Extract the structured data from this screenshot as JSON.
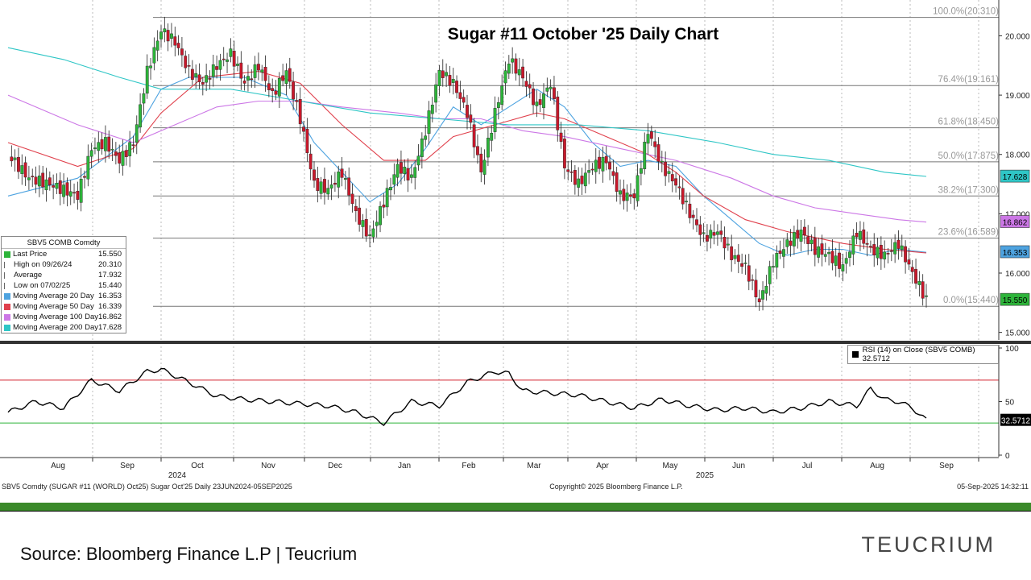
{
  "chart_data": {
    "type": "candlestick",
    "title": "Sugar #11 October '25 Daily Chart",
    "ylim": [
      14.9,
      20.4
    ],
    "y_ticks": [
      "15.000",
      "16.000",
      "17.000",
      "18.000",
      "19.000",
      "20.000"
    ],
    "x_labels": [
      "Aug",
      "Sep",
      "Oct",
      "Nov",
      "Dec",
      "Jan",
      "Feb",
      "Mar",
      "Apr",
      "May",
      "Jun",
      "Jul",
      "Aug",
      "Sep"
    ],
    "year_labels": [
      "2024",
      "2025"
    ],
    "fib_levels": [
      {
        "label": "100.0%(20.310)",
        "value": 20.31
      },
      {
        "label": "76.4%(19.161)",
        "value": 19.161
      },
      {
        "label": "61.8%(18.450)",
        "value": 18.45
      },
      {
        "label": "50.0%(17.875)",
        "value": 17.875
      },
      {
        "label": "38.2%(17.300)",
        "value": 17.3
      },
      {
        "label": "23.6%(16.589)",
        "value": 16.589
      },
      {
        "label": "0.0%(15.440)",
        "value": 15.44
      }
    ],
    "price_series": [
      {
        "name": "SBV5 COMB Comdty",
        "color": "#000000",
        "points": [
          [
            0,
            18.0
          ],
          [
            3,
            17.6
          ],
          [
            6,
            17.5
          ],
          [
            8,
            17.4
          ],
          [
            10,
            17.3
          ],
          [
            12,
            18.1
          ],
          [
            14,
            18.2
          ],
          [
            16,
            17.9
          ],
          [
            18,
            18.2
          ],
          [
            20,
            19.4
          ],
          [
            22,
            20.1
          ],
          [
            24,
            19.9
          ],
          [
            26,
            19.4
          ],
          [
            28,
            19.2
          ],
          [
            30,
            19.5
          ],
          [
            32,
            19.7
          ],
          [
            34,
            19.2
          ],
          [
            36,
            19.5
          ],
          [
            38,
            19.0
          ],
          [
            40,
            19.4
          ],
          [
            42,
            18.6
          ],
          [
            44,
            17.5
          ],
          [
            46,
            17.4
          ],
          [
            48,
            17.7
          ],
          [
            50,
            17.0
          ],
          [
            52,
            16.6
          ],
          [
            54,
            17.2
          ],
          [
            56,
            17.8
          ],
          [
            58,
            17.6
          ],
          [
            60,
            18.4
          ],
          [
            62,
            19.4
          ],
          [
            64,
            19.2
          ],
          [
            66,
            18.7
          ],
          [
            68,
            17.7
          ],
          [
            70,
            18.7
          ],
          [
            72,
            19.6
          ],
          [
            74,
            19.3
          ],
          [
            76,
            18.8
          ],
          [
            78,
            19.2
          ],
          [
            80,
            17.8
          ],
          [
            82,
            17.5
          ],
          [
            84,
            17.8
          ],
          [
            86,
            17.9
          ],
          [
            88,
            17.3
          ],
          [
            90,
            17.3
          ],
          [
            92,
            18.4
          ],
          [
            94,
            17.8
          ],
          [
            96,
            17.5
          ],
          [
            98,
            17.0
          ],
          [
            100,
            16.6
          ],
          [
            102,
            16.7
          ],
          [
            104,
            16.3
          ],
          [
            106,
            16.1
          ],
          [
            108,
            15.5
          ],
          [
            110,
            16.2
          ],
          [
            112,
            16.5
          ],
          [
            114,
            16.7
          ],
          [
            116,
            16.4
          ],
          [
            118,
            16.3
          ],
          [
            120,
            16.1
          ],
          [
            122,
            16.7
          ],
          [
            124,
            16.4
          ],
          [
            126,
            16.3
          ],
          [
            128,
            16.5
          ],
          [
            130,
            16.0
          ],
          [
            132,
            15.55
          ]
        ]
      },
      {
        "name": "Moving Average 20 Day",
        "color": "#4ea3e0",
        "points": [
          [
            0,
            17.3
          ],
          [
            10,
            17.6
          ],
          [
            18,
            18.3
          ],
          [
            22,
            19.1
          ],
          [
            26,
            19.3
          ],
          [
            34,
            19.3
          ],
          [
            40,
            19.0
          ],
          [
            44,
            18.2
          ],
          [
            48,
            17.7
          ],
          [
            52,
            17.2
          ],
          [
            56,
            17.5
          ],
          [
            60,
            18.1
          ],
          [
            64,
            18.8
          ],
          [
            68,
            18.5
          ],
          [
            72,
            18.8
          ],
          [
            76,
            19.1
          ],
          [
            80,
            18.8
          ],
          [
            84,
            18.2
          ],
          [
            88,
            17.8
          ],
          [
            92,
            17.9
          ],
          [
            96,
            17.8
          ],
          [
            100,
            17.3
          ],
          [
            104,
            16.9
          ],
          [
            108,
            16.5
          ],
          [
            112,
            16.3
          ],
          [
            116,
            16.4
          ],
          [
            120,
            16.4
          ],
          [
            124,
            16.3
          ],
          [
            128,
            16.4
          ],
          [
            132,
            16.35
          ]
        ]
      },
      {
        "name": "Moving Average 50 Day",
        "color": "#e0404c",
        "points": [
          [
            0,
            18.2
          ],
          [
            10,
            17.8
          ],
          [
            18,
            18.1
          ],
          [
            22,
            18.7
          ],
          [
            28,
            19.3
          ],
          [
            36,
            19.4
          ],
          [
            42,
            19.2
          ],
          [
            48,
            18.5
          ],
          [
            54,
            17.9
          ],
          [
            60,
            17.9
          ],
          [
            64,
            18.3
          ],
          [
            70,
            18.5
          ],
          [
            76,
            18.7
          ],
          [
            80,
            18.6
          ],
          [
            86,
            18.3
          ],
          [
            92,
            18.0
          ],
          [
            96,
            17.7
          ],
          [
            100,
            17.3
          ],
          [
            106,
            16.9
          ],
          [
            112,
            16.7
          ],
          [
            116,
            16.6
          ],
          [
            120,
            16.5
          ],
          [
            126,
            16.4
          ],
          [
            132,
            16.34
          ]
        ]
      },
      {
        "name": "Moving Average 100 Day",
        "color": "#cc77e6",
        "points": [
          [
            0,
            19.0
          ],
          [
            10,
            18.5
          ],
          [
            18,
            18.2
          ],
          [
            24,
            18.5
          ],
          [
            30,
            18.8
          ],
          [
            36,
            18.9
          ],
          [
            42,
            18.9
          ],
          [
            48,
            18.8
          ],
          [
            56,
            18.7
          ],
          [
            62,
            18.6
          ],
          [
            68,
            18.6
          ],
          [
            74,
            18.4
          ],
          [
            80,
            18.3
          ],
          [
            88,
            18.1
          ],
          [
            96,
            17.9
          ],
          [
            104,
            17.6
          ],
          [
            110,
            17.3
          ],
          [
            116,
            17.1
          ],
          [
            122,
            17.0
          ],
          [
            128,
            16.9
          ],
          [
            132,
            16.86
          ]
        ]
      },
      {
        "name": "Moving Average 200 Day",
        "color": "#2fc6c6",
        "points": [
          [
            0,
            19.8
          ],
          [
            8,
            19.6
          ],
          [
            16,
            19.3
          ],
          [
            22,
            19.1
          ],
          [
            32,
            19.1
          ],
          [
            42,
            18.9
          ],
          [
            52,
            18.7
          ],
          [
            62,
            18.6
          ],
          [
            72,
            18.5
          ],
          [
            82,
            18.5
          ],
          [
            92,
            18.4
          ],
          [
            102,
            18.2
          ],
          [
            110,
            18.0
          ],
          [
            118,
            17.9
          ],
          [
            126,
            17.7
          ],
          [
            132,
            17.63
          ]
        ]
      }
    ],
    "price_tags": [
      {
        "value": "17.628",
        "y": 17.628,
        "color": "#2fc6c6"
      },
      {
        "value": "16.862",
        "y": 16.862,
        "color": "#cc77e6"
      },
      {
        "value": "16.353",
        "y": 16.353,
        "color": "#4ea3e0"
      },
      {
        "value": "15.550",
        "y": 15.55,
        "color": "#2db43a"
      }
    ],
    "rsi": {
      "ylim": [
        0,
        100
      ],
      "y_ticks": [
        "0",
        "50",
        "100"
      ],
      "overbought": 70,
      "oversold": 30,
      "last_value": "32.5712",
      "points": [
        [
          0,
          40
        ],
        [
          4,
          50
        ],
        [
          8,
          44
        ],
        [
          12,
          70
        ],
        [
          16,
          60
        ],
        [
          20,
          78
        ],
        [
          22,
          80
        ],
        [
          26,
          68
        ],
        [
          30,
          55
        ],
        [
          34,
          52
        ],
        [
          38,
          50
        ],
        [
          42,
          48
        ],
        [
          46,
          46
        ],
        [
          50,
          40
        ],
        [
          54,
          30
        ],
        [
          58,
          50
        ],
        [
          62,
          46
        ],
        [
          66,
          68
        ],
        [
          70,
          78
        ],
        [
          72,
          76
        ],
        [
          74,
          60
        ],
        [
          78,
          58
        ],
        [
          82,
          56
        ],
        [
          86,
          50
        ],
        [
          90,
          44
        ],
        [
          94,
          52
        ],
        [
          98,
          46
        ],
        [
          102,
          42
        ],
        [
          106,
          44
        ],
        [
          110,
          40
        ],
        [
          114,
          44
        ],
        [
          118,
          50
        ],
        [
          122,
          46
        ],
        [
          124,
          62
        ],
        [
          126,
          52
        ],
        [
          128,
          50
        ],
        [
          130,
          44
        ],
        [
          132,
          32.57
        ]
      ]
    },
    "legend": {
      "title": "SBV5 COMB Comdty",
      "rows": [
        {
          "label": "Last Price",
          "value": "15.550",
          "color": "#2db43a"
        },
        {
          "label": "High on 09/26/24",
          "value": "20.310",
          "color": ""
        },
        {
          "label": "Average",
          "value": "17.932",
          "color": ""
        },
        {
          "label": "Low on 07/02/25",
          "value": "15.440",
          "color": ""
        },
        {
          "label": "Moving Average 20 Day",
          "value": "16.353",
          "color": "#4ea3e0"
        },
        {
          "label": "Moving Average 50 Day",
          "value": "16.339",
          "color": "#e0404c"
        },
        {
          "label": "Moving Average 100 Day",
          "value": "16.862",
          "color": "#cc77e6"
        },
        {
          "label": "Moving Average 200 Day",
          "value": "17.628",
          "color": "#2fc6c6"
        }
      ]
    },
    "rsi_label": "RSI (14)  on Close (SBV5 COMB) 32.5712",
    "bottom_left": "SBV5 Comdty (SUGAR #11 (WORLD) Oct25) Sugar Oct'25  Daily 23JUN2024-05SEP2025",
    "bottom_center": "Copyright© 2025 Bloomberg Finance L.P.",
    "bottom_right": "05-Sep-2025 14:32:11"
  },
  "footer": {
    "source": "Source: Bloomberg Finance L.P | Teucrium",
    "logo": "TEUCRIUM"
  }
}
